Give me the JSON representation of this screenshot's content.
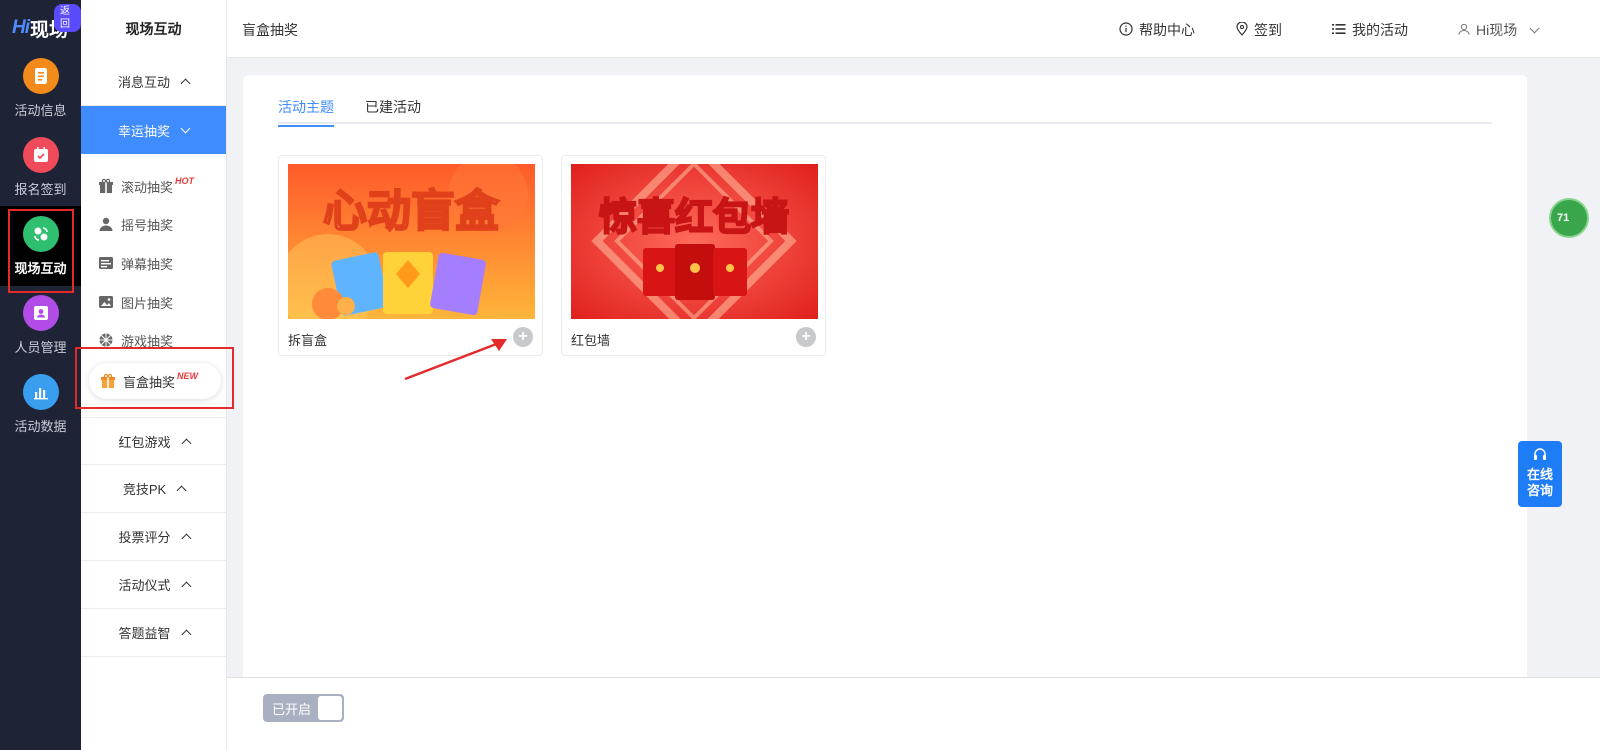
{
  "rail": {
    "logo_hi": "Hi",
    "logo_text": "现场",
    "back_badge": "返回",
    "items": [
      {
        "label": "活动信息",
        "icon": "document-icon",
        "color": "#f28a1c"
      },
      {
        "label": "报名签到",
        "icon": "checkin-calendar-icon",
        "color": "#ef4b5a"
      },
      {
        "label": "现场互动",
        "icon": "interaction-icon",
        "color": "#2fbf70"
      },
      {
        "label": "人员管理",
        "icon": "people-icon",
        "color": "#b14ce6"
      },
      {
        "label": "活动数据",
        "icon": "bar-chart-icon",
        "color": "#3a9ef0"
      }
    ]
  },
  "submenu": {
    "title": "现场互动",
    "groups": [
      "消息互动",
      "幸运抽奖",
      "红包游戏",
      "竞技PK",
      "投票评分",
      "活动仪式",
      "答题益智"
    ],
    "lottery_items": [
      {
        "label": "滚动抽奖",
        "badge": "HOT"
      },
      {
        "label": "摇号抽奖",
        "badge": ""
      },
      {
        "label": "弹幕抽奖",
        "badge": ""
      },
      {
        "label": "图片抽奖",
        "badge": ""
      },
      {
        "label": "游戏抽奖",
        "badge": ""
      },
      {
        "label": "盲盒抽奖",
        "badge": "NEW"
      }
    ]
  },
  "header": {
    "page_title": "盲盒抽奖",
    "help": "帮助中心",
    "checkin": "签到",
    "my_activities": "我的活动",
    "user": "Hi现场"
  },
  "tabs": [
    "活动主题",
    "已建活动"
  ],
  "cards": [
    {
      "label": "拆盲盒",
      "banner_text": "心动盲盒"
    },
    {
      "label": "红包墙",
      "banner_text": "惊喜红包墙"
    }
  ],
  "bottom": {
    "toggle_label": "已开启"
  },
  "float": {
    "bubble": "71",
    "consult_line1": "在线",
    "consult_line2": "咨询"
  },
  "colors": {
    "accent": "#3f8cff",
    "rail_bg": "#1f2336",
    "highlight": "#e32b2b"
  }
}
